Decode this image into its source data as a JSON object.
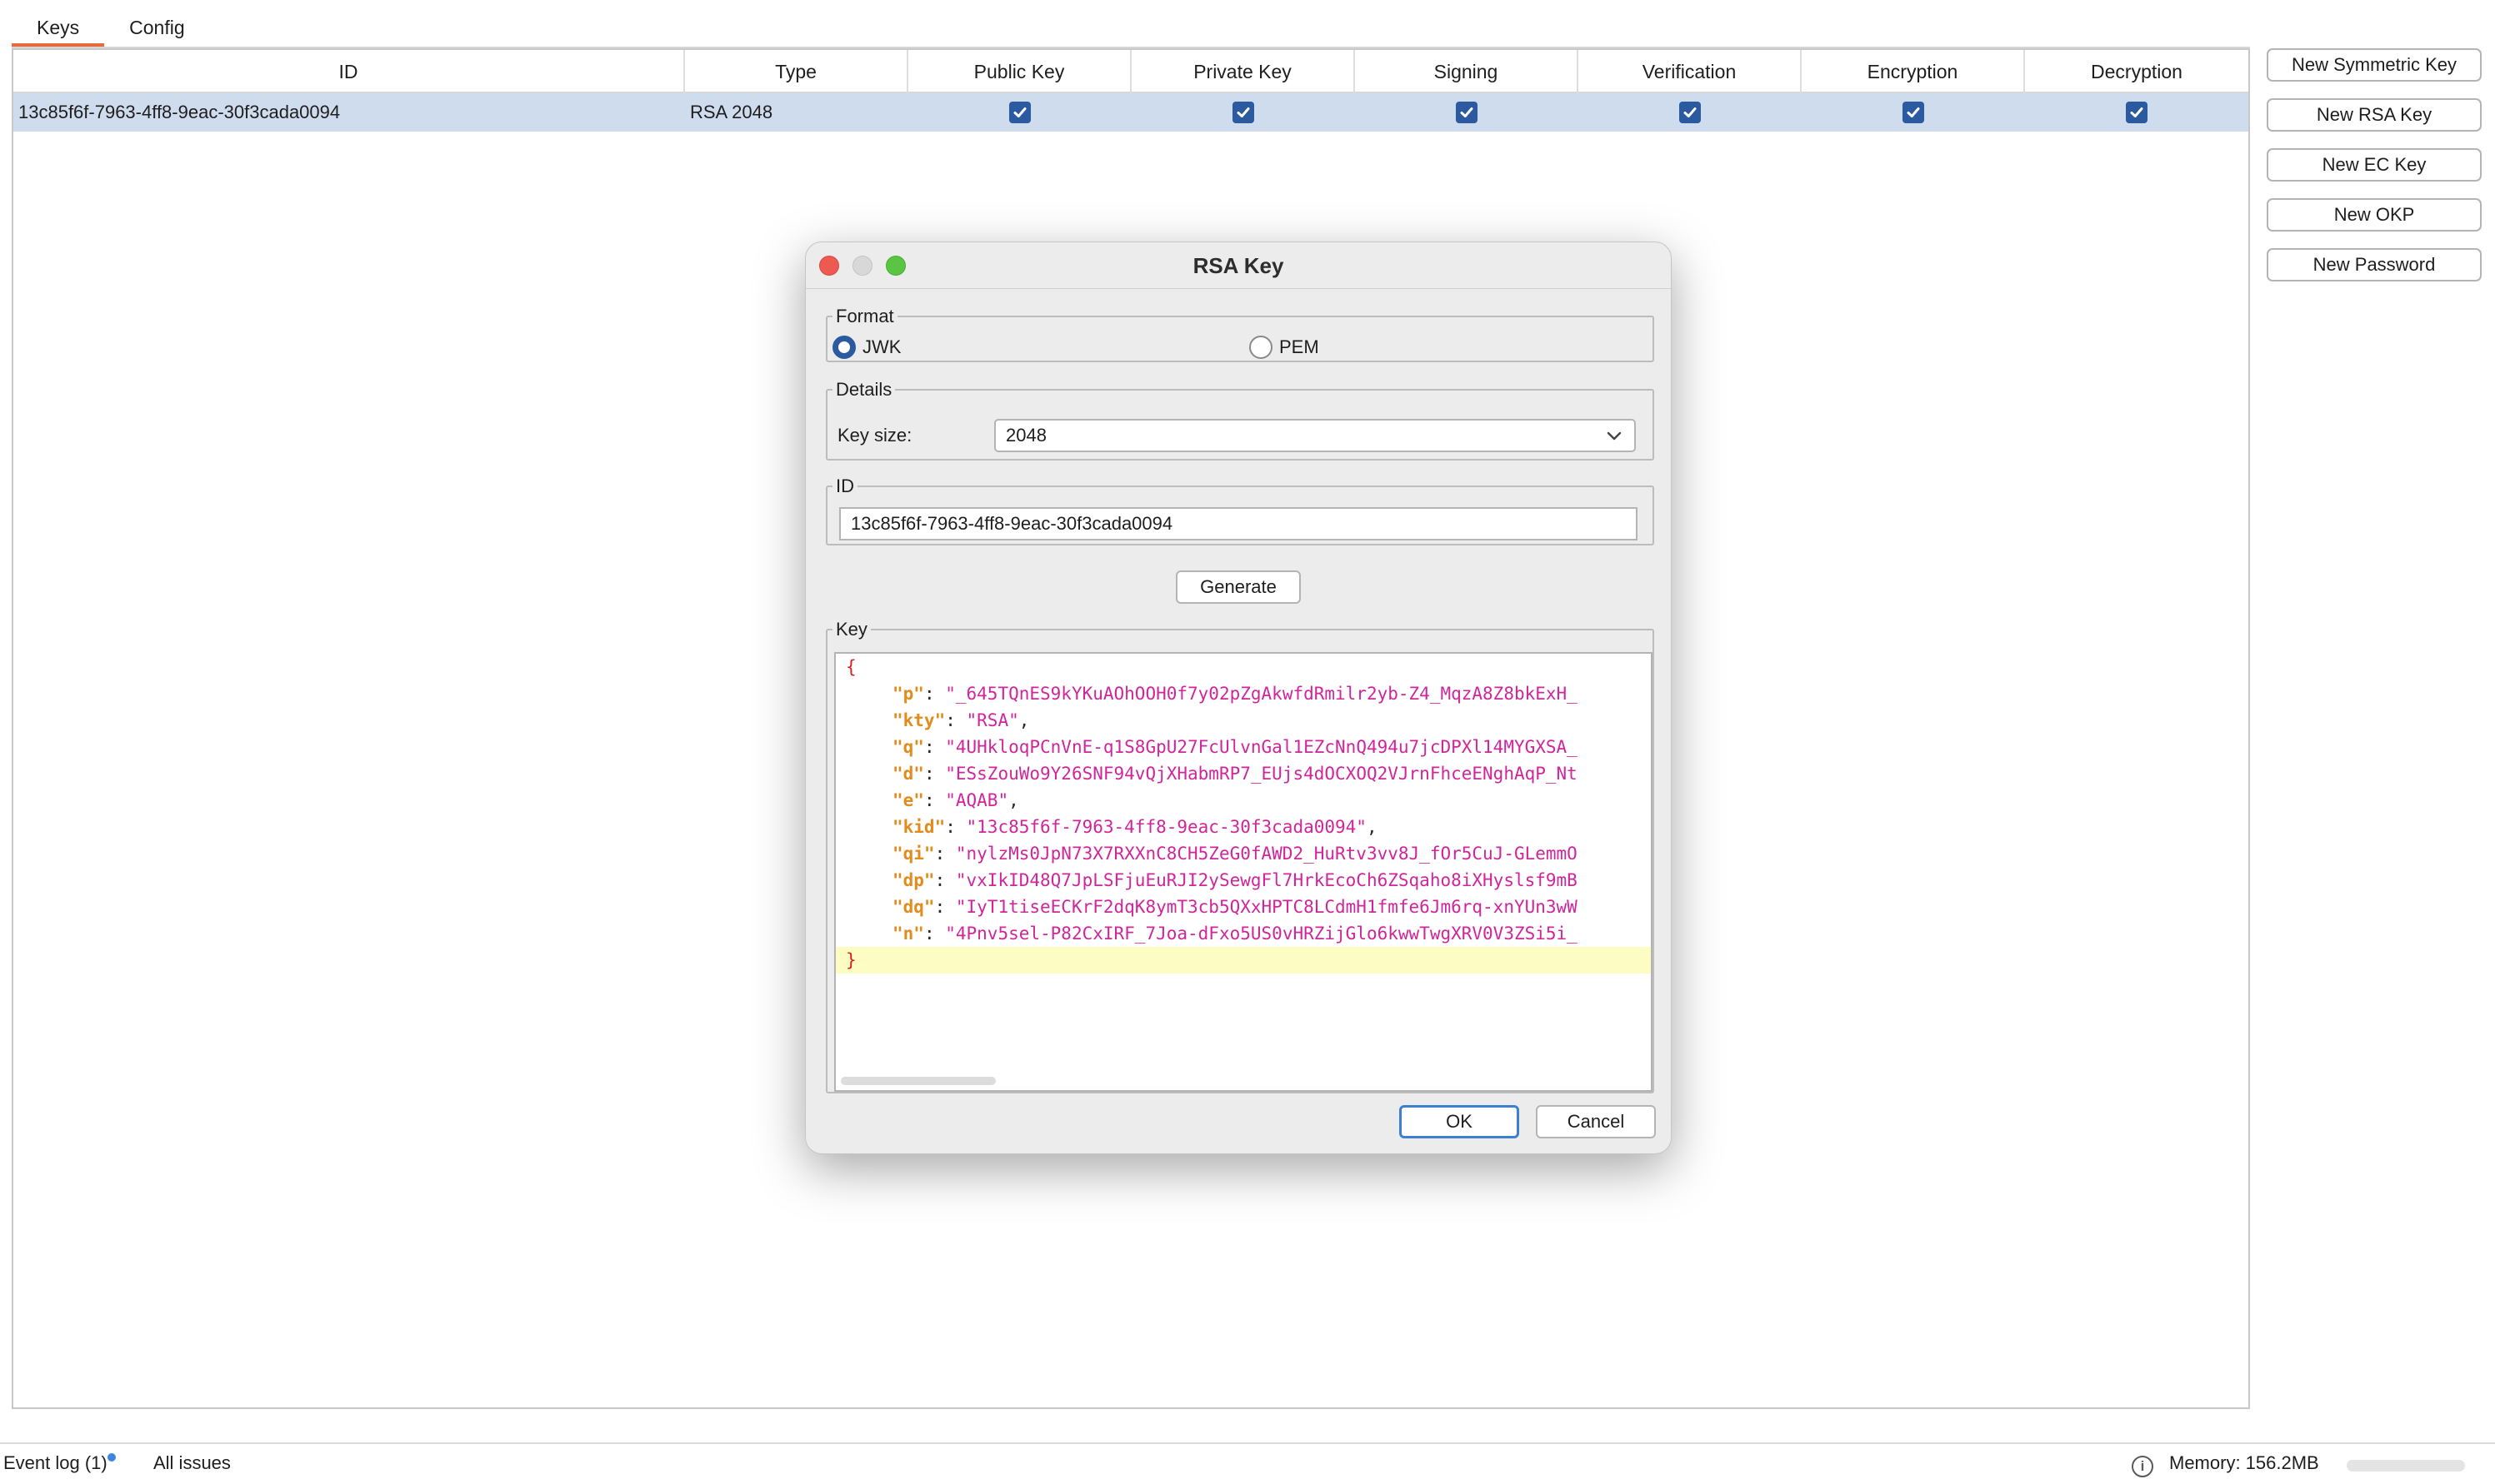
{
  "tabs": [
    {
      "label": "Keys",
      "active": true
    },
    {
      "label": "Config",
      "active": false
    }
  ],
  "table": {
    "columns": [
      "ID",
      "Type",
      "Public Key",
      "Private Key",
      "Signing",
      "Verification",
      "Encryption",
      "Decryption"
    ],
    "rows": [
      {
        "id": "13c85f6f-7963-4ff8-9eac-30f3cada0094",
        "type": "RSA 2048",
        "public_key": true,
        "private_key": true,
        "signing": true,
        "verification": true,
        "encryption": true,
        "decryption": true
      }
    ]
  },
  "side_buttons": {
    "new_symmetric": "New Symmetric Key",
    "new_rsa": "New RSA Key",
    "new_ec": "New EC Key",
    "new_okp": "New OKP",
    "new_password": "New Password"
  },
  "dialog": {
    "title": "RSA Key",
    "format": {
      "legend": "Format",
      "options": [
        "JWK",
        "PEM"
      ],
      "selected": "JWK"
    },
    "details": {
      "legend": "Details",
      "key_size_label": "Key size:",
      "key_size_value": "2048"
    },
    "id_group": {
      "legend": "ID",
      "value": "13c85f6f-7963-4ff8-9eac-30f3cada0094"
    },
    "generate_label": "Generate",
    "key_group": {
      "legend": "Key",
      "open_brace": "{",
      "close_brace": "}",
      "entries": [
        {
          "key": "\"p\"",
          "value": "\"_645TQnES9kYKuAOhOOH0f7y02pZgAkwfdRmilr2yb-Z4_MqzA8Z8bkExH_"
        },
        {
          "key": "\"kty\"",
          "value": "\"RSA\""
        },
        {
          "key": "\"q\"",
          "value": "\"4UHkloqPCnVnE-q1S8GpU27FcUlvnGal1EZcNnQ494u7jcDPXl14MYGXSA_"
        },
        {
          "key": "\"d\"",
          "value": "\"ESsZouWo9Y26SNF94vQjXHabmRP7_EUjs4dOCXOQ2VJrnFhceENghAqP_Nt"
        },
        {
          "key": "\"e\"",
          "value": "\"AQAB\""
        },
        {
          "key": "\"kid\"",
          "value": "\"13c85f6f-7963-4ff8-9eac-30f3cada0094\""
        },
        {
          "key": "\"qi\"",
          "value": "\"nylzMs0JpN73X7RXXnC8CH5ZeG0fAWD2_HuRtv3vv8J_fOr5CuJ-GLemmO"
        },
        {
          "key": "\"dp\"",
          "value": "\"vxIkID48Q7JpLSFjuEuRJI2ySewgFl7HrkEcoCh6ZSqaho8iXHyslsf9mB"
        },
        {
          "key": "\"dq\"",
          "value": "\"IyT1tiseECKrF2dqK8ymT3cb5QXxHPTC8LCdmH1fmfe6Jm6rq-xnYUn3wW"
        },
        {
          "key": "\"n\"",
          "value": "\"4Pnv5sel-P82CxIRF_7Joa-dFxo5US0vHRZijGlo6kwwTwgXRV0V3ZSi5i_"
        }
      ]
    },
    "ok_label": "OK",
    "cancel_label": "Cancel"
  },
  "status_bar": {
    "event_log": "Event log (1)",
    "all_issues": "All issues",
    "memory": "Memory: 156.2MB"
  },
  "colors": {
    "accent_tab": "#e8693e",
    "selection_row": "#cfdcee",
    "checkbox": "#2c5aa0",
    "json_key": "#e38b1d",
    "json_string": "#d0259c",
    "json_brace": "#d0231d",
    "line_highlight": "#fdfcc2"
  }
}
